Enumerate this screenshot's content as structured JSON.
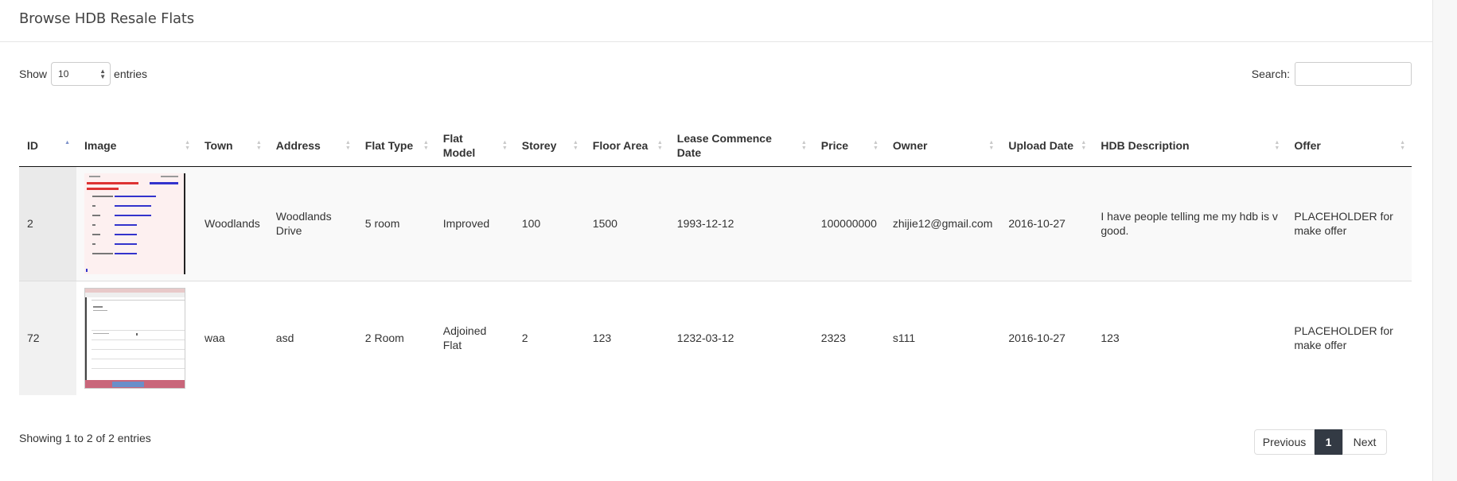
{
  "header": {
    "title": "Browse HDB Resale Flats"
  },
  "length": {
    "show_label": "Show",
    "value": "10",
    "entries_label": "entries"
  },
  "search": {
    "label": "Search:",
    "value": ""
  },
  "table": {
    "columns": [
      "ID",
      "Image",
      "Town",
      "Address",
      "Flat Type",
      "Flat Model",
      "Storey",
      "Floor Area",
      "Lease Commence Date",
      "Price",
      "Owner",
      "Upload Date",
      "HDB Description",
      "Offer"
    ],
    "rows": [
      {
        "id": "2",
        "town": "Woodlands",
        "address": "Woodlands Drive",
        "flat_type": "5 room",
        "flat_model": "Improved",
        "storey": "100",
        "floor_area": "1500",
        "lease_date": "1993-12-12",
        "price": "100000000",
        "owner": "zhijie12@gmail.com",
        "upload_date": "2016-10-27",
        "description": "I have people telling me my hdb is v good.",
        "offer": "PLACEHOLDER for make offer"
      },
      {
        "id": "72",
        "town": "waa",
        "address": "asd",
        "flat_type": "2 Room",
        "flat_model": "Adjoined Flat",
        "storey": "2",
        "floor_area": "123",
        "lease_date": "1232-03-12",
        "price": "2323",
        "owner": "s111",
        "upload_date": "2016-10-27",
        "description": "123",
        "offer": "PLACEHOLDER for make offer"
      }
    ]
  },
  "footer": {
    "info": "Showing 1 to 2 of 2 entries",
    "pagination": {
      "previous": "Previous",
      "current": "1",
      "next": "Next"
    }
  },
  "colors": {
    "accent_dark": "#333a44",
    "sort_active": "#7b90c9",
    "stripe": "#f9f9f9"
  }
}
